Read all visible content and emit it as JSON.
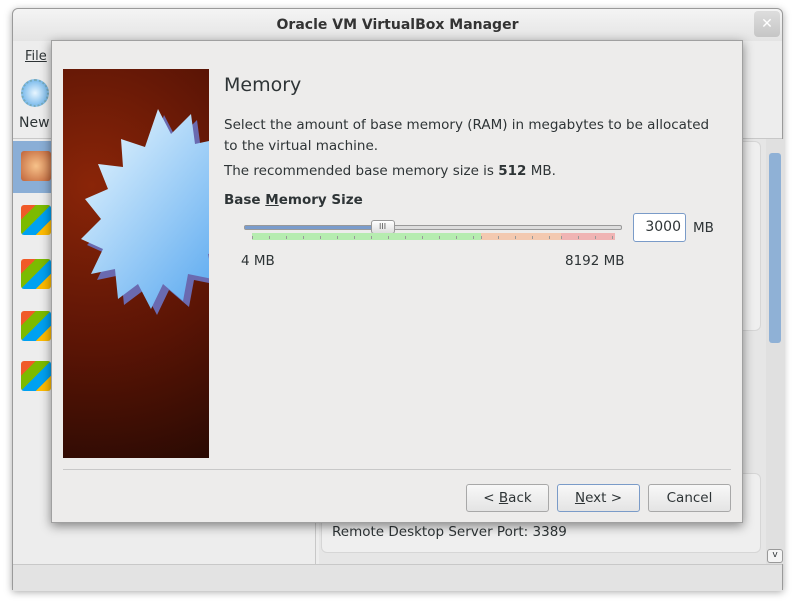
{
  "window": {
    "title": "Oracle VM VirtualBox Manager",
    "close_icon": "close-icon"
  },
  "menu": {
    "file": "File"
  },
  "toolbar": {
    "new": "New"
  },
  "vm_list": {
    "items": [
      {
        "badge": "64"
      },
      {
        "badge": "vista"
      },
      {
        "badge": "xp"
      },
      {
        "badge": "7"
      },
      {
        "badge": "7"
      }
    ]
  },
  "details": {
    "remote_desktop": "Remote Desktop Server Port: 3389"
  },
  "dialog": {
    "heading": "Memory",
    "description": "Select the amount of base memory (RAM) in megabytes to be allocated to the virtual machine.",
    "recommended_prefix": "The recommended base memory size is ",
    "recommended_value": "512",
    "recommended_suffix": " MB.",
    "slider_label_pre": "Base ",
    "slider_label_mnemonic": "M",
    "slider_label_post": "emory Size",
    "memory_value": "3000",
    "unit": "MB",
    "min_label": "4 MB",
    "max_label": "8192 MB",
    "slider": {
      "min": 4,
      "max": 8192,
      "value": 3000,
      "safe_fraction": 0.63,
      "warn_fraction": 0.85
    },
    "buttons": {
      "back_pre": "< ",
      "back_m": "B",
      "back_post": "ack",
      "next_m": "N",
      "next_post": "ext >",
      "cancel": "Cancel"
    }
  }
}
